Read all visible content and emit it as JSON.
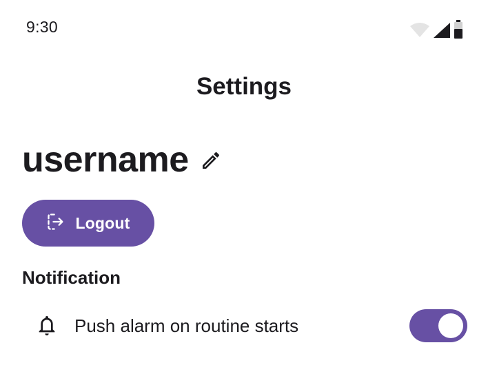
{
  "status_bar": {
    "time": "9:30",
    "icons": [
      "wifi-icon",
      "cellular-signal-icon",
      "battery-icon"
    ]
  },
  "app_bar": {
    "title": "Settings"
  },
  "profile": {
    "username": "username",
    "edit_icon": "pencil-icon"
  },
  "logout_button": {
    "label": "Logout",
    "icon": "logout-icon"
  },
  "notification_section": {
    "title": "Notification",
    "items": [
      {
        "icon": "bell-icon",
        "label": "Push alarm on routine starts",
        "enabled": true
      }
    ]
  },
  "colors": {
    "primary": "#6750a4",
    "text": "#1c1b1f",
    "background": "#ffffff"
  }
}
